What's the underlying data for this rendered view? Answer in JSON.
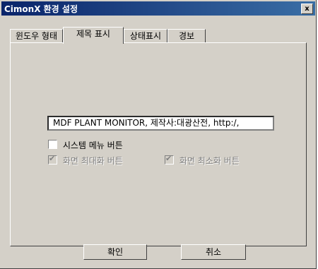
{
  "window": {
    "title": "CimonX 환경 설정",
    "close_label": "x"
  },
  "tabs": [
    {
      "label": "윈도우 형태"
    },
    {
      "label": "제목 표시"
    },
    {
      "label": "상태표시"
    },
    {
      "label": "경보"
    }
  ],
  "title_field": {
    "value": "MDF PLANT MONITOR,   제작사:대광산전,  http:/,"
  },
  "checkboxes": [
    {
      "label": "시스템 메뉴 버튼",
      "checked": false,
      "enabled": true
    },
    {
      "label": "화면 최대화 버튼",
      "checked": true,
      "enabled": false
    },
    {
      "label": "화면 최소화 버튼",
      "checked": true,
      "enabled": false
    }
  ],
  "buttons": {
    "ok": "확인",
    "cancel": "취소"
  }
}
